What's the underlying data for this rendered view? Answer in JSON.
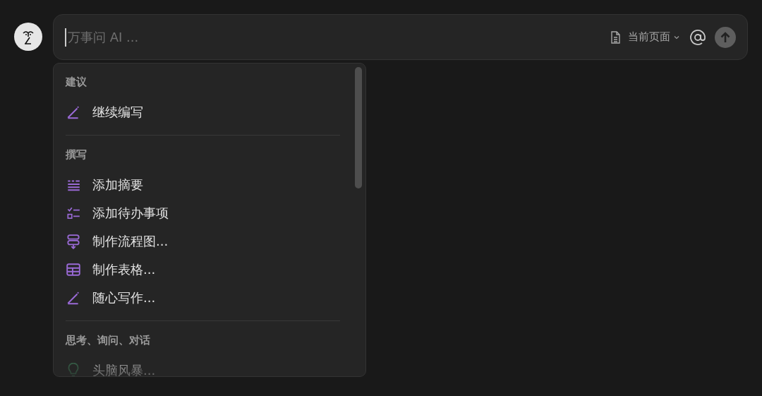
{
  "prompt": {
    "placeholder": "万事问 AI ...",
    "scope": "当前页面"
  },
  "menu": {
    "sections": [
      {
        "heading": "建议",
        "items": [
          {
            "label": "继续编写",
            "kind": "pen"
          }
        ]
      },
      {
        "heading": "撰写",
        "items": [
          {
            "label": "添加摘要",
            "kind": "summary"
          },
          {
            "label": "添加待办事项",
            "kind": "checklist"
          },
          {
            "label": "制作流程图...",
            "kind": "flow"
          },
          {
            "label": "制作表格...",
            "kind": "table"
          },
          {
            "label": "随心写作...",
            "kind": "pen"
          }
        ]
      },
      {
        "heading": "思考、询问、对话",
        "items": [
          {
            "label": "头脑风暴...",
            "kind": "bulb"
          }
        ]
      }
    ]
  }
}
